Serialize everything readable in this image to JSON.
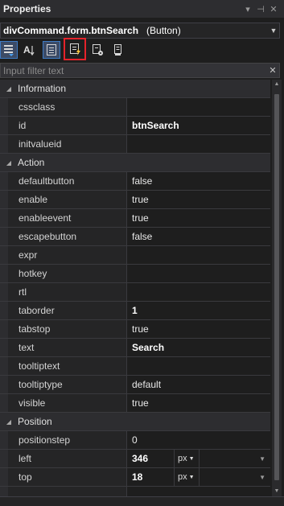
{
  "panel": {
    "title": "Properties",
    "controls": [
      "▾",
      "⊣",
      "✕"
    ]
  },
  "selector": {
    "object": "divCommand.form.btnSearch",
    "type": "(Button)"
  },
  "toolbar": {
    "buttons": [
      "categorized",
      "alphabetical",
      "properties",
      "events",
      "custom",
      "extra"
    ]
  },
  "filter": {
    "placeholder": "Input filter text"
  },
  "grid": {
    "categories": [
      {
        "name": "Information",
        "rows": [
          {
            "name": "cssclass",
            "value": ""
          },
          {
            "name": "id",
            "value": "btnSearch",
            "bold": true
          },
          {
            "name": "initvalueid",
            "value": ""
          }
        ]
      },
      {
        "name": "Action",
        "rows": [
          {
            "name": "defaultbutton",
            "value": "false"
          },
          {
            "name": "enable",
            "value": "true"
          },
          {
            "name": "enableevent",
            "value": "true"
          },
          {
            "name": "escapebutton",
            "value": "false"
          },
          {
            "name": "expr",
            "value": ""
          },
          {
            "name": "hotkey",
            "value": ""
          },
          {
            "name": "rtl",
            "value": ""
          },
          {
            "name": "taborder",
            "value": "1",
            "bold": true
          },
          {
            "name": "tabstop",
            "value": "true"
          },
          {
            "name": "text",
            "value": "Search",
            "bold": true
          },
          {
            "name": "tooltiptext",
            "value": ""
          },
          {
            "name": "tooltiptype",
            "value": "default"
          },
          {
            "name": "visible",
            "value": "true"
          }
        ]
      },
      {
        "name": "Position",
        "rows": [
          {
            "name": "positionstep",
            "value": "0"
          },
          {
            "name": "left",
            "value": "346",
            "bold": true,
            "unit": "px"
          },
          {
            "name": "top",
            "value": "18",
            "bold": true,
            "unit": "px"
          },
          {
            "name": "",
            "value": ""
          }
        ]
      }
    ]
  }
}
